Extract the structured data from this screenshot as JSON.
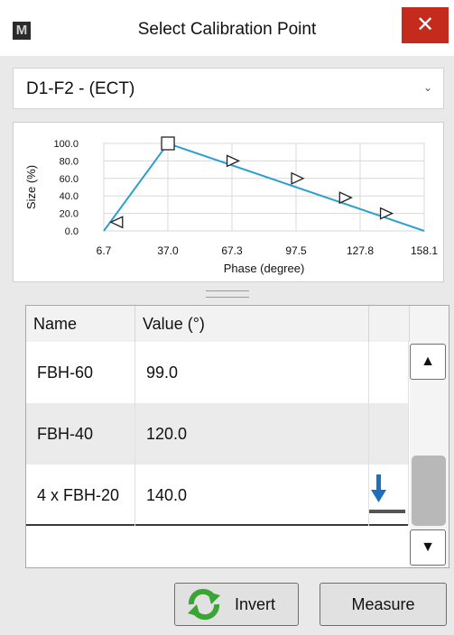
{
  "window": {
    "title": "Select Calibration Point",
    "app_icon": "M",
    "close_glyph": "✕"
  },
  "dropdown": {
    "value": "D1-F2 - (ECT)"
  },
  "chart_data": {
    "type": "line",
    "xlabel": "Phase (degree)",
    "ylabel": "Size (%)",
    "x_ticks": [
      "6.7",
      "37.0",
      "67.3",
      "97.5",
      "127.8",
      "158.1"
    ],
    "y_ticks": [
      "0.0",
      "20.0",
      "40.0",
      "60.0",
      "80.0",
      "100.0"
    ],
    "xlim": [
      6.7,
      158.1
    ],
    "ylim": [
      0,
      100
    ],
    "grid": true,
    "series": [
      {
        "x": [
          6.7,
          37.0,
          158.1
        ],
        "y": [
          0,
          100,
          0
        ]
      }
    ],
    "markers": [
      {
        "x": 13,
        "y": 10,
        "shape": "triangle-left"
      },
      {
        "x": 37.0,
        "y": 100,
        "shape": "square"
      },
      {
        "x": 67.5,
        "y": 80,
        "shape": "triangle-right"
      },
      {
        "x": 98,
        "y": 60,
        "shape": "triangle-right"
      },
      {
        "x": 120.7,
        "y": 38,
        "shape": "triangle-right"
      },
      {
        "x": 140,
        "y": 20,
        "shape": "triangle-right"
      }
    ],
    "line_color": "#2a9fd0"
  },
  "table": {
    "headers": [
      "Name",
      "Value (°)"
    ],
    "rows": [
      {
        "name": "FBH-60",
        "value": "99.0"
      },
      {
        "name": "FBH-40",
        "value": "120.0"
      },
      {
        "name": "4 x FBH-20",
        "value": "140.0"
      }
    ],
    "selected_row_icon": "arrow-down-to-bar-icon"
  },
  "scrollbar": {
    "up_glyph": "▲",
    "down_glyph": "▼"
  },
  "buttons": {
    "invert": "Invert",
    "measure": "Measure"
  },
  "colors": {
    "close_red": "#c42b1c",
    "invert_icon_green": "#3aa535",
    "arrow_blue": "#1f6fbf"
  }
}
